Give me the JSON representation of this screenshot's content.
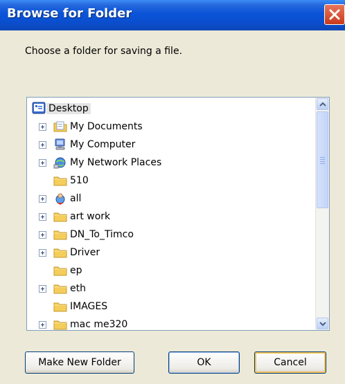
{
  "dialog": {
    "title": "Browse for Folder",
    "prompt": "Choose a folder for saving a file."
  },
  "tree": {
    "root": {
      "label": "Desktop",
      "icon": "desktop-icon",
      "selected": true
    },
    "items": [
      {
        "label": "My Documents",
        "icon": "documents-folder-icon",
        "expandable": true
      },
      {
        "label": "My Computer",
        "icon": "computer-icon",
        "expandable": true
      },
      {
        "label": "My Network Places",
        "icon": "network-places-icon",
        "expandable": true
      },
      {
        "label": "510",
        "icon": "folder-icon",
        "expandable": false
      },
      {
        "label": "all",
        "icon": "globe-user-icon",
        "expandable": true
      },
      {
        "label": "art work",
        "icon": "folder-icon",
        "expandable": true
      },
      {
        "label": "DN_To_Timco",
        "icon": "folder-icon",
        "expandable": true
      },
      {
        "label": "Driver",
        "icon": "folder-icon",
        "expandable": true
      },
      {
        "label": "ep",
        "icon": "folder-icon",
        "expandable": false
      },
      {
        "label": "eth",
        "icon": "folder-icon",
        "expandable": true
      },
      {
        "label": "IMAGES",
        "icon": "folder-icon",
        "expandable": false
      },
      {
        "label": "mac me320",
        "icon": "folder-icon",
        "expandable": true
      }
    ]
  },
  "buttons": {
    "make_new_folder": "Make New Folder",
    "ok": "OK",
    "cancel": "Cancel"
  },
  "colors": {
    "titlebar": "#0a54d8",
    "dialog_bg": "#ece9d8",
    "close": "#d54b2c",
    "folder": "#f4cd5a"
  }
}
